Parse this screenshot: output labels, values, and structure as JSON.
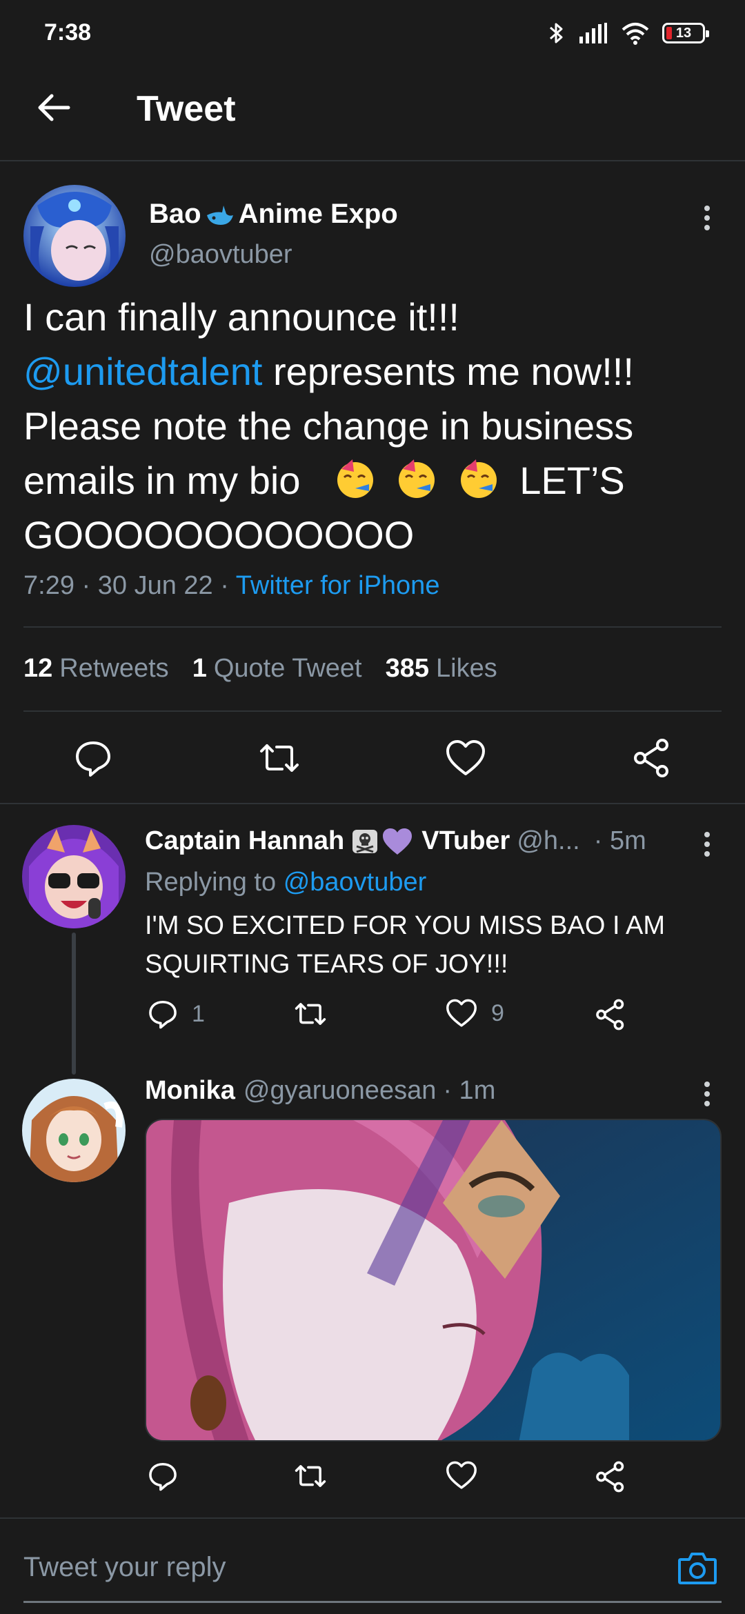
{
  "status_bar": {
    "time": "7:38",
    "battery": "13"
  },
  "header": {
    "title": "Tweet"
  },
  "main_tweet": {
    "author_name": "Bao",
    "author_name_suffix": "Anime Expo",
    "handle": "@baovtuber",
    "text_line1": "I can finally announce it!!!",
    "mention": "@unitedtalent",
    "text_after_mention": " represents me now!!!",
    "text_line3": "Please note the change in business",
    "text_line4": "emails in my bio",
    "text_after_emoji": "LET’S",
    "text_line5": "GOOOOOOOOOOOO",
    "time": "7:29",
    "date": "30 Jun 22",
    "source": "Twitter for iPhone",
    "stats": {
      "retweets_count": "12",
      "retweets_label": "Retweets",
      "quotes_count": "1",
      "quotes_label": "Quote Tweet",
      "likes_count": "385",
      "likes_label": "Likes"
    }
  },
  "replies": [
    {
      "name": "Captain Hannah",
      "name_suffix": "VTuber",
      "handle": "@h...",
      "time": "· 5m",
      "replying_prefix": "Replying to",
      "replying_to": "@baovtuber",
      "text_line1": "I'M SO EXCITED FOR YOU MISS BAO I AM",
      "text_line2": "SQUIRTING TEARS OF JOY!!!",
      "reply_count": "1",
      "like_count": "9"
    },
    {
      "name": "Monika",
      "handle": "@gyaruoneesan",
      "time": "· 1m"
    }
  ],
  "reply_bar": {
    "placeholder": "Tweet your reply"
  },
  "colors": {
    "background": "#1b1b1b",
    "accent": "#1d9bf0",
    "muted": "#8b98a5",
    "divider": "#2f3336"
  }
}
